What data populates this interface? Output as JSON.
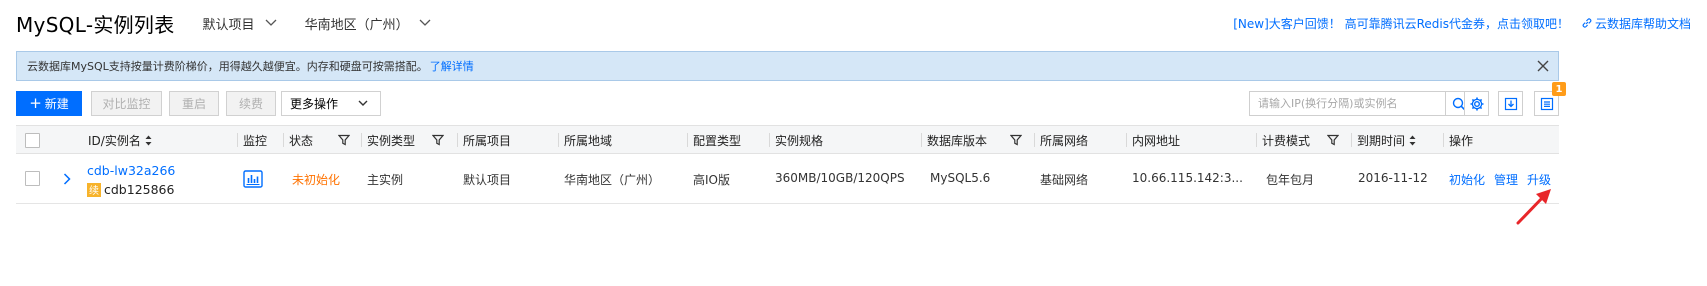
{
  "header": {
    "title": "MySQL-实例列表",
    "project_dropdown": "默认项目",
    "region_dropdown": "华南地区（广州）",
    "promo": "[New]大客户回馈！ 高可靠腾讯云Redis代金券，点击领取吧！",
    "help_link": "云数据库帮助文档"
  },
  "notice": {
    "text": "云数据库MySQL支持按量计费阶梯价，用得越久越便宜。内存和硬盘可按需搭配。",
    "link": "了解详情"
  },
  "toolbar": {
    "new_label": "新建",
    "monitor_compare": "对比监控",
    "restart": "重启",
    "renew": "续费",
    "more_ops": "更多操作",
    "search_placeholder": "请输入IP(换行分隔)或实例名",
    "notification_count": "1"
  },
  "table": {
    "columns": {
      "id": "ID/实例名",
      "monitor": "监控",
      "status": "状态",
      "type": "实例类型",
      "project": "所属项目",
      "region": "所属地域",
      "config": "配置类型",
      "spec": "实例规格",
      "version": "数据库版本",
      "network": "所属网络",
      "ip": "内网地址",
      "billing": "计费模式",
      "expire": "到期时间",
      "ops": "操作"
    },
    "rows": [
      {
        "id": "cdb-lw32a266",
        "renew_badge": "续",
        "name": "cdb125866",
        "status": "未初始化",
        "type": "主实例",
        "project": "默认项目",
        "region": "华南地区（广州）",
        "config": "高IO版",
        "spec": "360MB/10GB/120QPS",
        "version": "MySQL5.6",
        "network": "基础网络",
        "ip": "10.66.115.142:3...",
        "billing": "包年包月",
        "expire": "2016-11-12",
        "op_init": "初始化",
        "op_manage": "管理",
        "op_upgrade": "升级"
      }
    ]
  },
  "colors": {
    "accent": "#006eff",
    "warning": "#ff7200",
    "badge": "#ff9c19",
    "annotation_arrow": "#e8262a"
  }
}
